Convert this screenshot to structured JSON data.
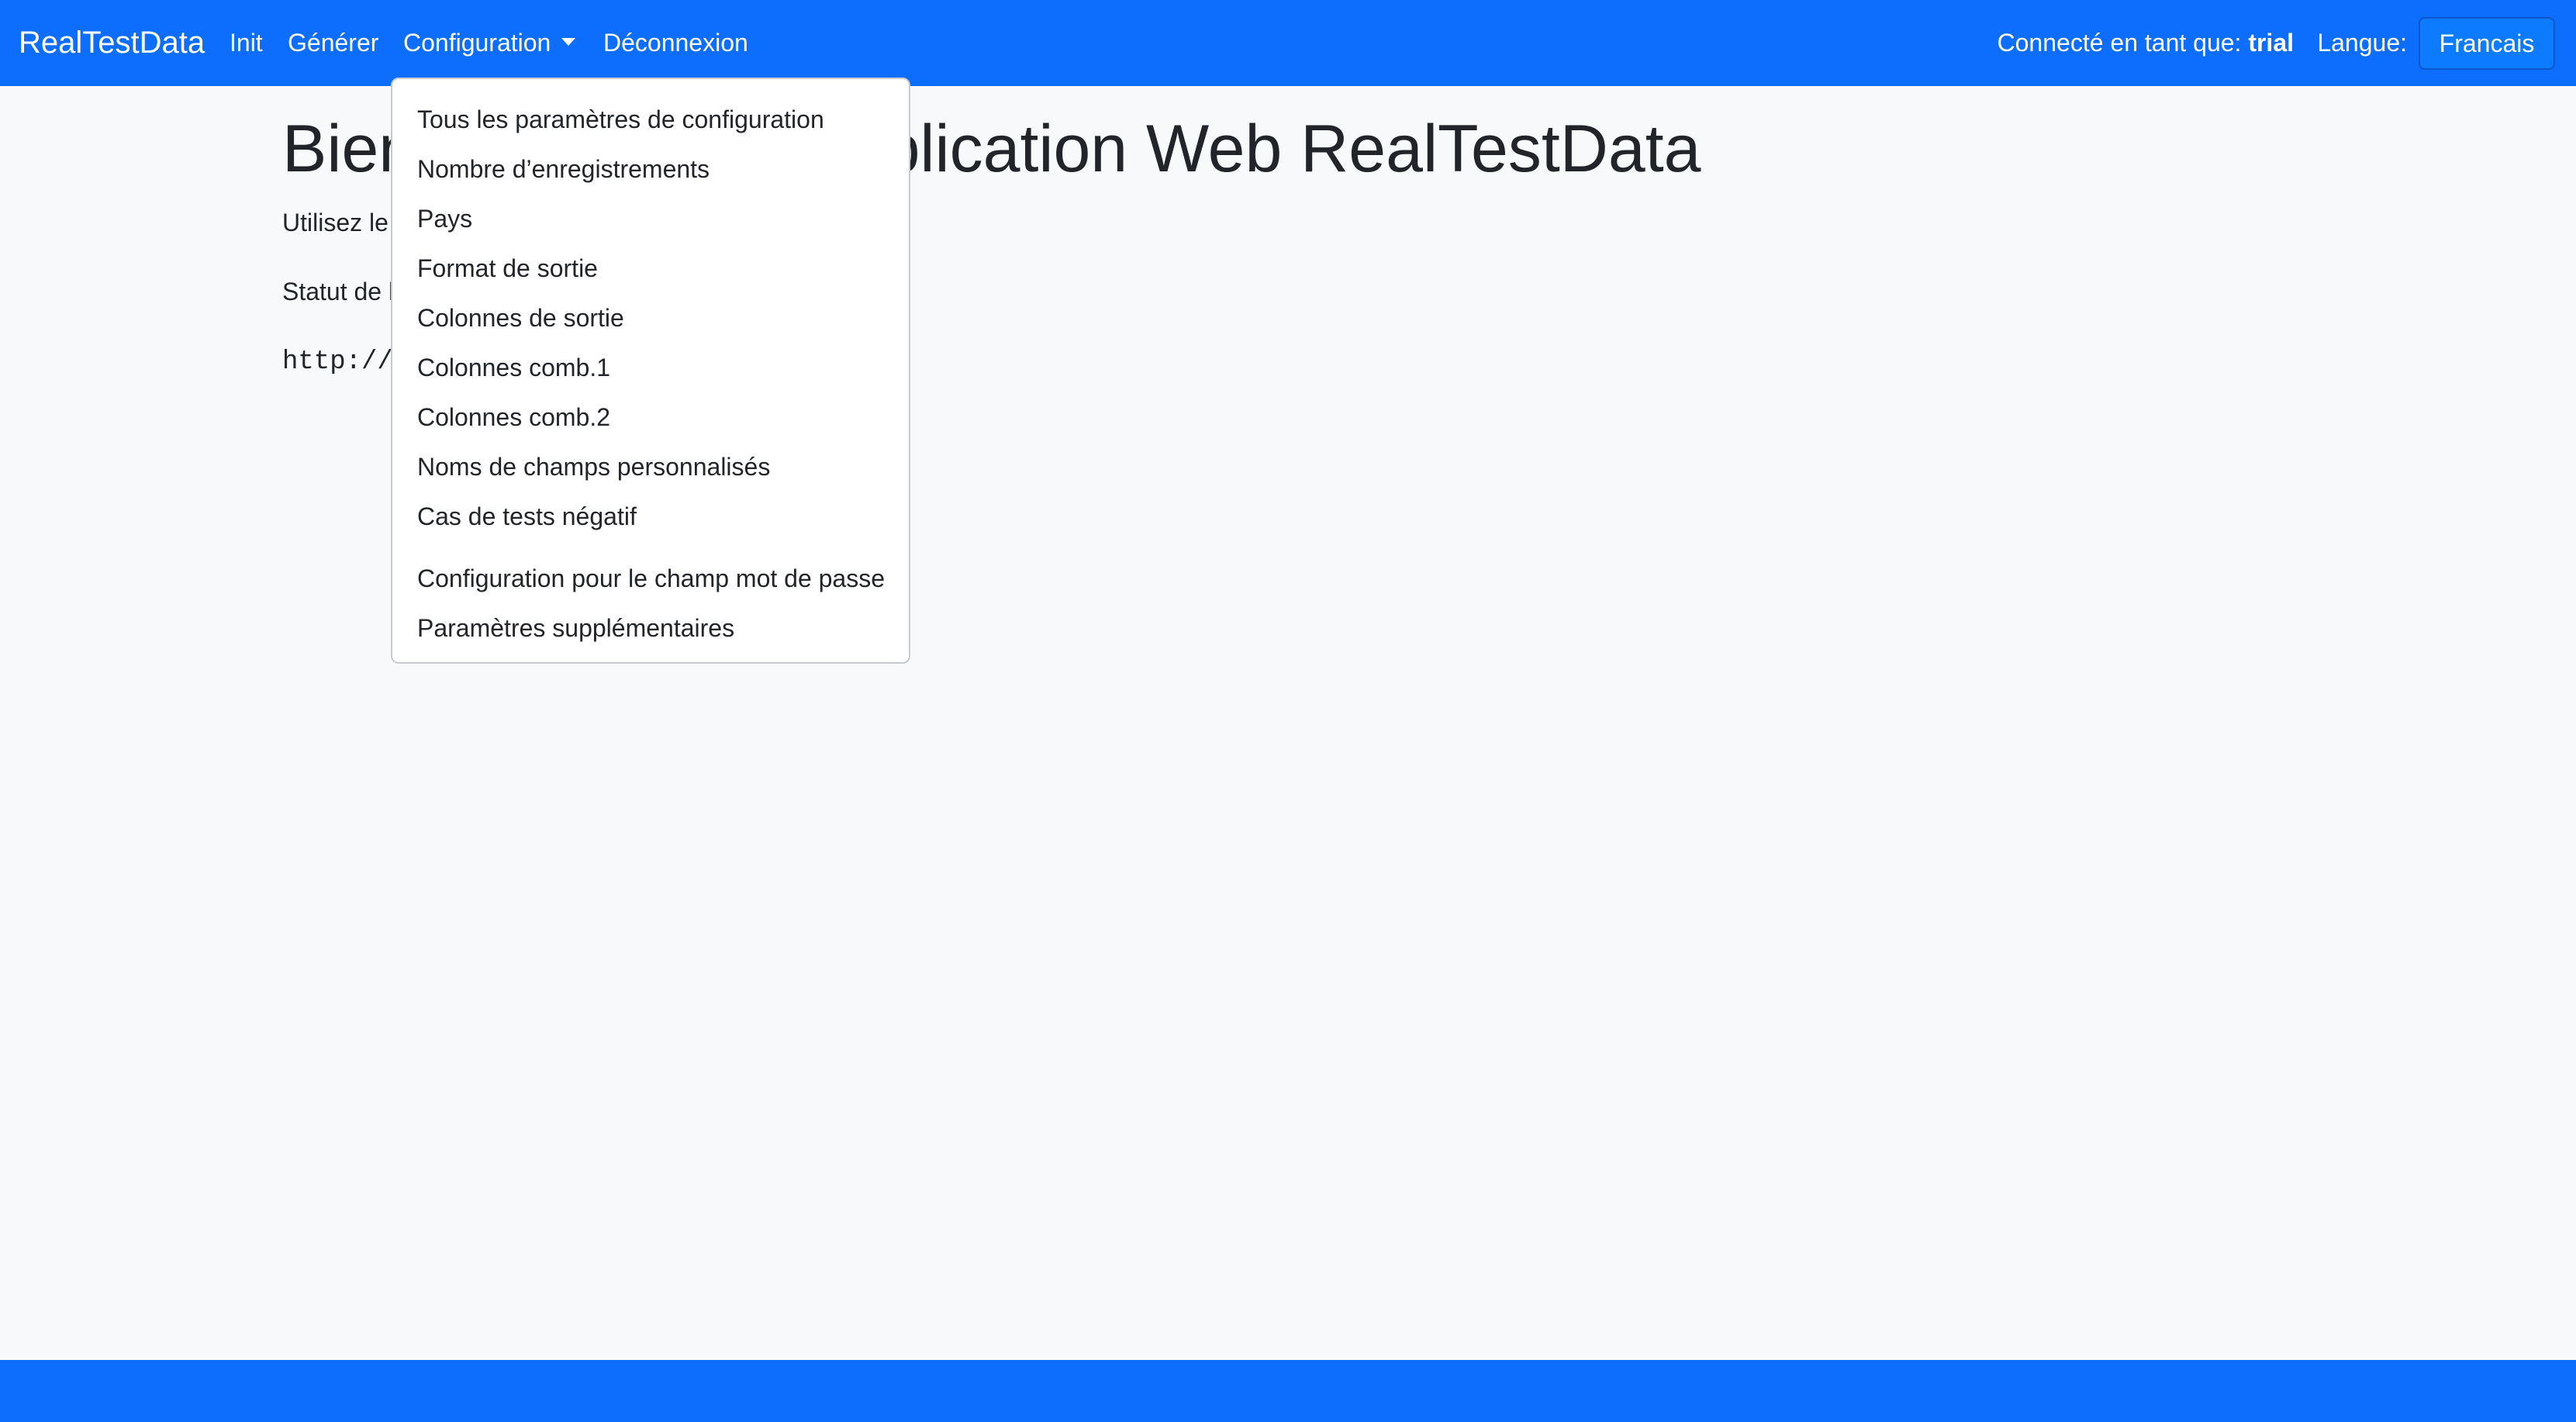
{
  "navbar": {
    "brand": "RealTestData",
    "links": {
      "init": "Init",
      "generate": "Générer",
      "configuration": "Configuration",
      "logout": "Déconnexion"
    },
    "logged_in_prefix": "Connecté en tant que:",
    "logged_in_user": "trial",
    "language_label": "Langue:",
    "language_value": "Francais"
  },
  "main": {
    "title": "Bienvenue dans l’application Web RealTestData",
    "intro": "Utilisez le menu ci-dessus pour naviguer.",
    "status": "Statut de l’API :",
    "url": "http://realtestdata"
  },
  "dropdown": {
    "group1": [
      "Tous les paramètres de configuration",
      "Nombre d’enregistrements",
      "Pays",
      "Format de sortie",
      "Colonnes de sortie",
      "Colonnes comb.1",
      "Colonnes comb.2",
      "Noms de champs personnalisés",
      "Cas de tests négatif"
    ],
    "group2": [
      "Configuration pour le champ mot de passe",
      "Paramètres supplémentaires"
    ]
  },
  "colors": {
    "primary": "#0d6efd",
    "background": "#f8f9fa",
    "text": "#212529"
  }
}
